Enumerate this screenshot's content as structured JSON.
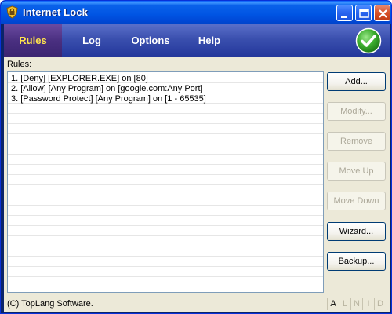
{
  "window": {
    "title": "Internet Lock",
    "controls": {
      "minimize": "minimize-icon",
      "maximize": "maximize-icon",
      "close": "close-icon"
    }
  },
  "nav": {
    "tabs": [
      {
        "label": "Rules",
        "active": true
      },
      {
        "label": "Log",
        "active": false
      },
      {
        "label": "Options",
        "active": false
      },
      {
        "label": "Help",
        "active": false
      }
    ],
    "ok_icon": "checkmark-icon"
  },
  "rules": {
    "label": "Rules:",
    "items": [
      "1. [Deny] [EXPLORER.EXE] on [80]",
      "2. [Allow] [Any Program] on [google.com:Any Port]",
      "3. [Password Protect] [Any Program] on [1 - 65535]"
    ]
  },
  "buttons": {
    "add": {
      "label": "Add...",
      "enabled": true
    },
    "modify": {
      "label": "Modify...",
      "enabled": false
    },
    "remove": {
      "label": "Remove",
      "enabled": false
    },
    "move_up": {
      "label": "Move Up",
      "enabled": false
    },
    "move_down": {
      "label": "Move Down",
      "enabled": false
    },
    "wizard": {
      "label": "Wizard...",
      "enabled": true
    },
    "backup": {
      "label": "Backup...",
      "enabled": true
    }
  },
  "status": {
    "copyright": "(C) TopLang Software.",
    "indicators": [
      {
        "label": "A",
        "on": true
      },
      {
        "label": "L",
        "on": false
      },
      {
        "label": "N",
        "on": false
      },
      {
        "label": "I",
        "on": false
      },
      {
        "label": "D",
        "on": false
      }
    ]
  },
  "colors": {
    "titlebar": "#0054e3",
    "navbar": "#3a4fae",
    "active_tab_text": "#ffe34d",
    "client_bg": "#ece9d8"
  }
}
